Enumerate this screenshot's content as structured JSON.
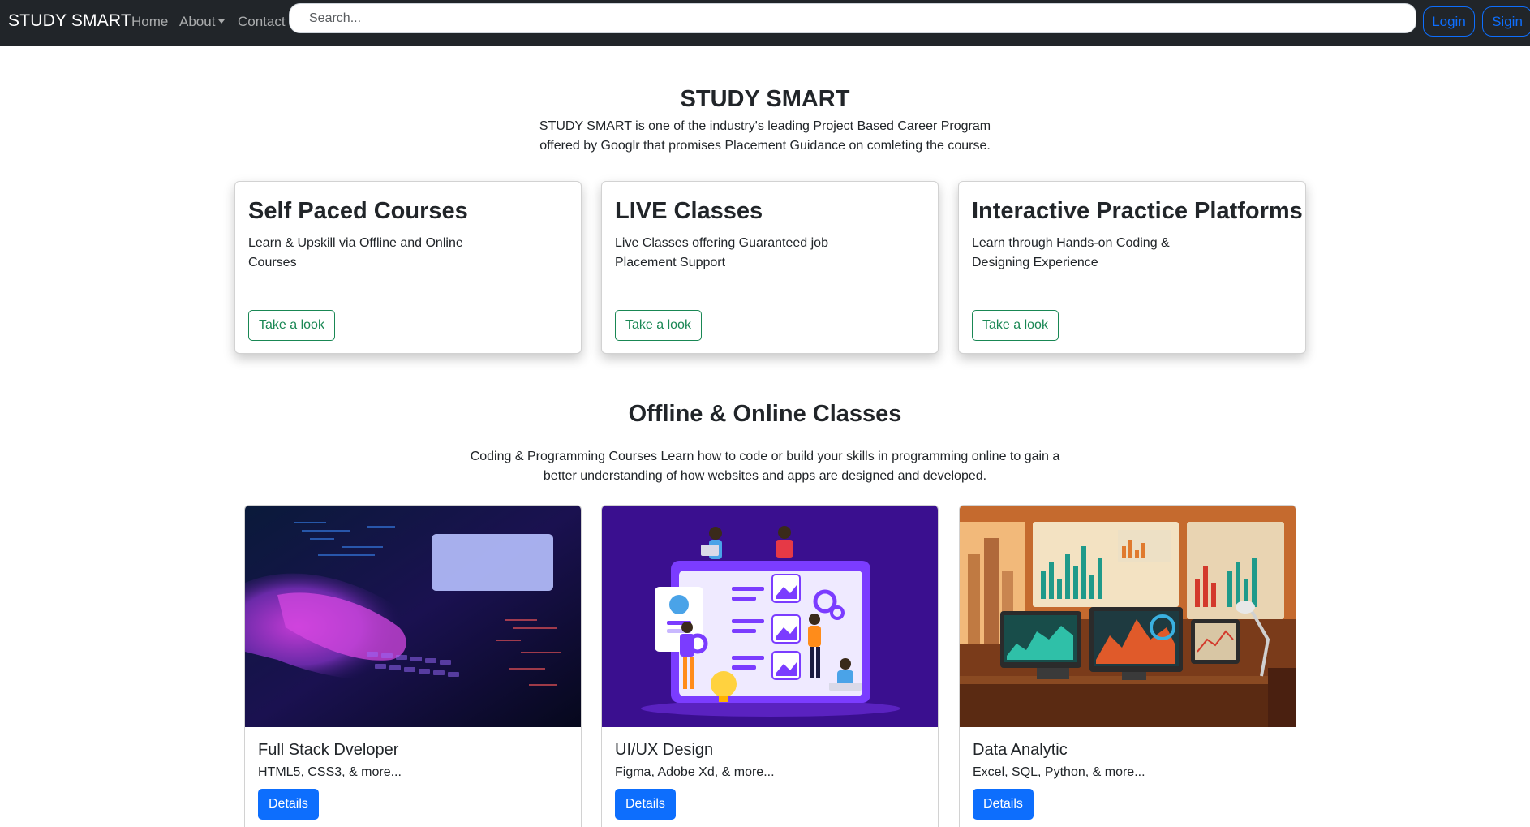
{
  "navbar": {
    "brand": "STUDY SMART",
    "links": [
      "Home",
      "About",
      "Contact"
    ],
    "search_placeholder": "Search...",
    "login_label": "Login",
    "sign_label": "Sigin"
  },
  "hero": {
    "title": "STUDY SMART",
    "description": "STUDY SMART is one of the industry's leading Project Based Career Program offered by Googlr that promises Placement Guidance on comleting the course."
  },
  "features": [
    {
      "title": "Self Paced Courses",
      "text": "Learn & Upskill via Offline and Online Courses",
      "button": "Take a look"
    },
    {
      "title": "LIVE Classes",
      "text": "Live Classes offering Guaranteed job Placement Support",
      "button": "Take a look"
    },
    {
      "title": "Interactive Practice Platforms",
      "text": "Learn through Hands-on Coding & Designing Experience",
      "button": "Take a look"
    }
  ],
  "classes": {
    "title": "Offline & Online Classes",
    "description": "Coding & Programming Courses Learn how to code or build your skills in programming online to gain a better understanding of how websites and apps are designed and developed."
  },
  "courses": [
    {
      "title": "Full Stack Dveloper",
      "subtitle": "HTML5, CSS3, & more...",
      "button": "Details",
      "image": "typing-on-keyboard-photo"
    },
    {
      "title": "UI/UX Design",
      "subtitle": "Figma, Adobe Xd, & more...",
      "button": "Details",
      "image": "ui-ux-illustration"
    },
    {
      "title": "Data Analytic",
      "subtitle": "Excel, SQL, Python, & more...",
      "button": "Details",
      "image": "data-dashboard-desk-illustration"
    }
  ],
  "colors": {
    "navbar_bg": "#212529",
    "primary": "#0d6efd",
    "success": "#198754",
    "uiux_bg": "#3a0f8f"
  }
}
